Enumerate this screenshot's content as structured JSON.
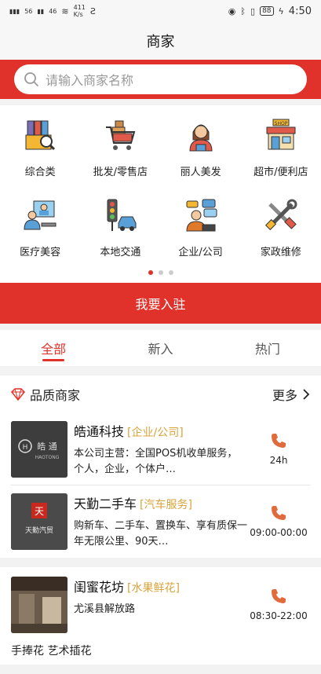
{
  "status": {
    "left_1": "56",
    "left_2": "46",
    "speed_value": "411",
    "speed_unit": "K/s",
    "battery": "88",
    "time": "4:50"
  },
  "nav": {
    "title": "商家"
  },
  "search": {
    "placeholder": "请输入商家名称"
  },
  "categories": {
    "row1": [
      "综合类",
      "批发/零售店",
      "丽人美发",
      "超市/便利店"
    ],
    "row2": [
      "医疗美容",
      "本地交通",
      "企业/公司",
      "家政维修"
    ],
    "pager": {
      "pages": 3,
      "active": 1
    }
  },
  "join_button": "我要入驻",
  "tabs": [
    "全部",
    "新入",
    "热门"
  ],
  "quality": {
    "title": "品质商家",
    "more": "更多"
  },
  "merchants": [
    {
      "name": "皓通科技",
      "tag": "[企业/公司]",
      "desc": "本公司主营：全国POS机收单服务，个人，企业，个体户…",
      "hours": "24h",
      "logo_text": "皓 通",
      "logo_sub": "HAOTONG"
    },
    {
      "name": "天勤二手车",
      "tag": "[汽车服务]",
      "desc": "购新车、二手车、置换车、享有质保一年无限公里、90天…",
      "hours": "09:00-00:00",
      "logo_text": "天勤汽贸"
    }
  ],
  "flower": {
    "name": "闺蜜花坊",
    "tag": "[水果鲜花]",
    "address": "尤溪县解放路",
    "hours": "08:30-22:00",
    "bottom_text": "手捧花 艺术插花"
  },
  "colors": {
    "brand_red": "#e0322a",
    "tag_gold": "#d9a33c",
    "phone_orange": "#e06b3c"
  }
}
